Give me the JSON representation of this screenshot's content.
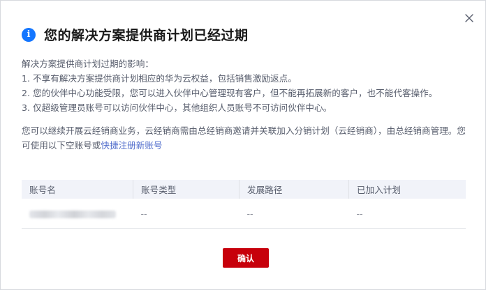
{
  "dialog": {
    "title": "您的解决方案提供商计划已经过期",
    "close_icon": "close-icon",
    "info_icon": "info-icon",
    "impact_heading": "解决方案提供商计划过期的影响：",
    "impacts": [
      "1. 不享有解决方案提供商计划相应的华为云权益，包括销售激励返点。",
      "2. 您的伙伴中心功能受限，您可以进入伙伴中心管理现有客户，但不能再拓展新的客户，也不能代客操作。",
      "3. 仅超级管理员账号可以访问伙伴中心，其他组织人员账号不可访问伙伴中心。"
    ],
    "continue_text": "您可以继续开展云经销商业务，云经销商需由总经销商邀请并关联加入分销计划（云经销商），由总经销商管理。您可使用以下空账号或",
    "register_link": "快捷注册新账号",
    "confirm_label": "确认",
    "accent_color": "#c7000b",
    "link_color": "#526ecc"
  },
  "table": {
    "headers": [
      "账号名",
      "账号类型",
      "发展路径",
      "已加入计划"
    ],
    "rows": [
      {
        "account_type": "--",
        "path": "--",
        "plans": "--"
      }
    ]
  }
}
